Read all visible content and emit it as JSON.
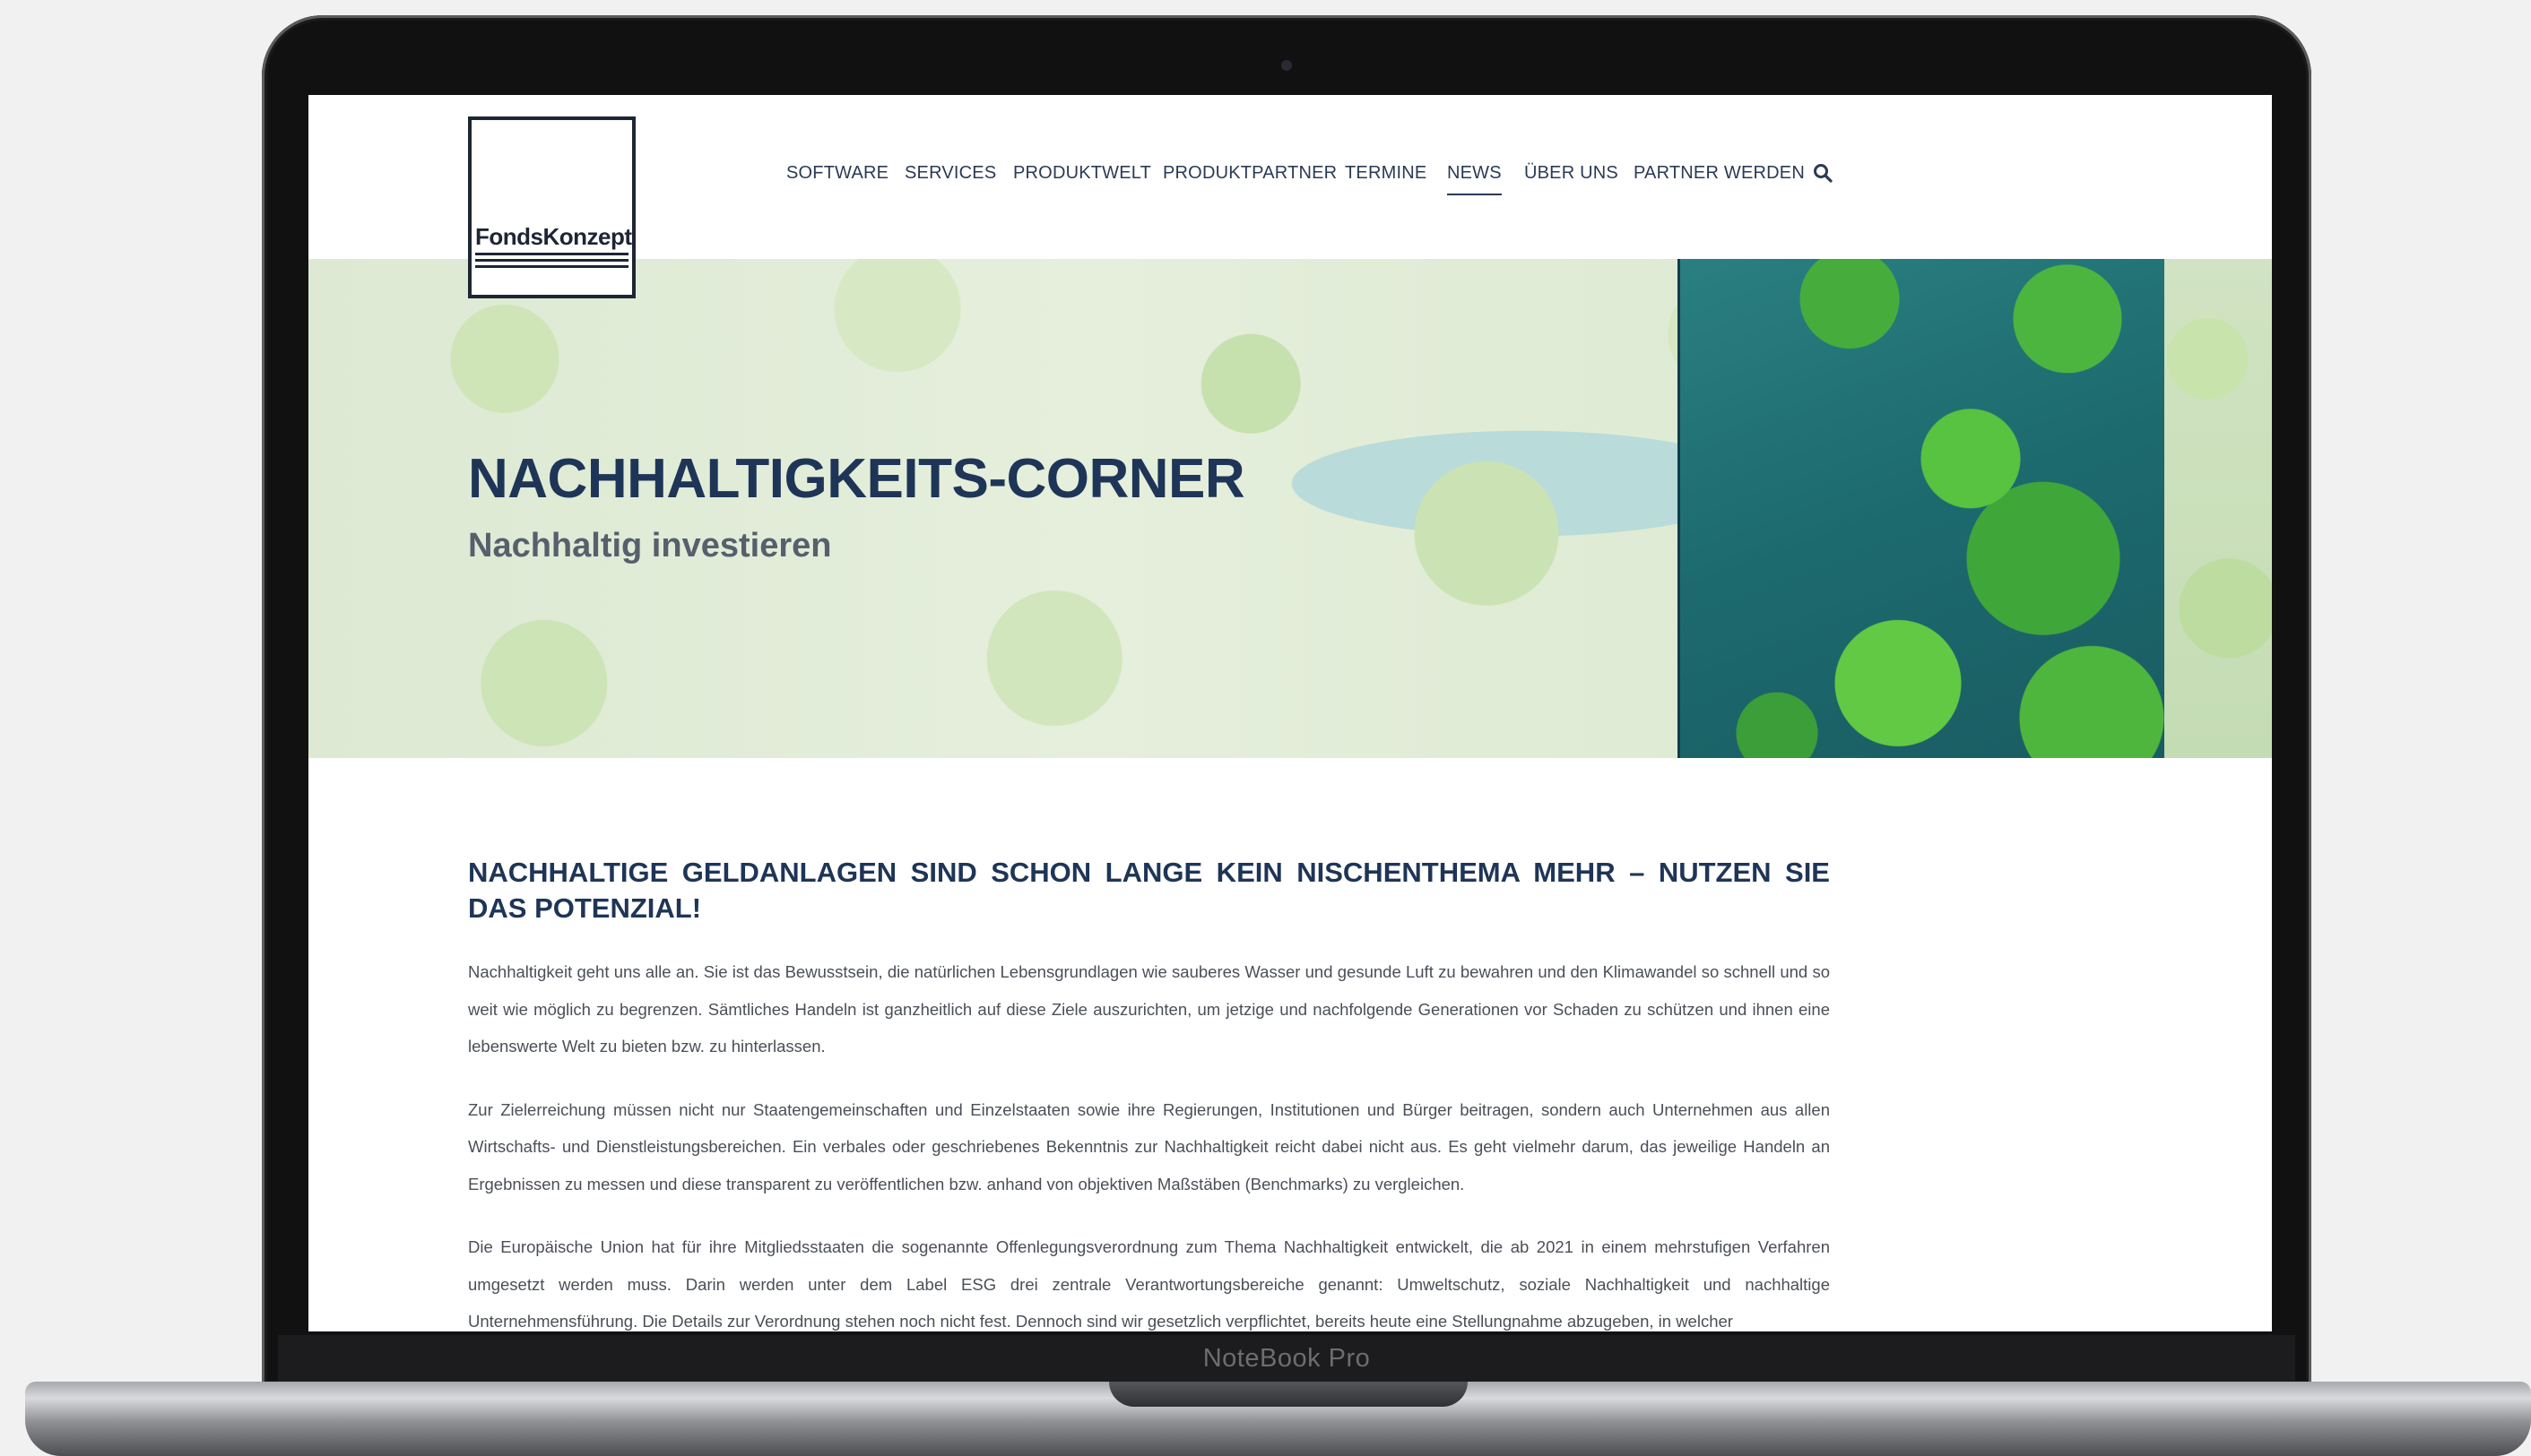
{
  "device": {
    "label": "NoteBook Pro"
  },
  "site": {
    "logo_text": "FondsKonzept",
    "nav": [
      "SOFTWARE",
      "SERVICES",
      "PRODUKTWELT",
      "PRODUKTPARTNER",
      "TERMINE",
      "NEWS",
      "ÜBER UNS",
      "PARTNER WERDEN"
    ],
    "active_nav": "NEWS",
    "search_icon": "search-icon"
  },
  "hero": {
    "title": "NACHHALTIGKEITS-CORNER",
    "subtitle": "Nachhaltig investieren"
  },
  "article": {
    "headline": "NACHHALTIGE GELDANLAGEN SIND SCHON LANGE KEIN NISCHENTHEMA MEHR – NUTZEN SIE DAS POTENZIAL!",
    "paragraphs": [
      "Nachhaltigkeit geht uns alle an. Sie ist das Bewusstsein, die natürlichen Lebensgrundlagen wie sauberes Wasser und gesunde Luft zu bewahren und den Klimawandel so schnell und so weit wie möglich zu begrenzen. Sämtliches Handeln ist ganzheitlich auf diese Ziele auszurichten, um jetzige und nachfolgende Generationen vor Schaden zu schützen und ihnen eine lebenswerte Welt zu bieten bzw. zu hinterlassen.",
      "Zur Zielerreichung müssen nicht nur Staatengemeinschaften und Einzelstaaten sowie ihre Regierungen, Institutionen und Bürger beitragen, sondern auch Unternehmen aus allen Wirtschafts- und Dienstleistungsbereichen. Ein verbales oder geschriebenes Bekenntnis zur Nachhaltigkeit reicht dabei nicht aus. Es geht vielmehr darum, das jeweilige Handeln an Ergebnissen zu messen und diese transparent zu veröffentlichen bzw. anhand von objektiven Maßstäben (Benchmarks) zu vergleichen.",
      "Die Europäische Union hat für ihre Mitgliedsstaaten die sogenannte Offenlegungsverordnung zum Thema Nachhaltigkeit entwickelt, die ab 2021 in einem mehrstufigen Verfahren umgesetzt werden muss. Darin werden unter dem Label ESG drei zentrale Verantwortungsbereiche genannt: Umweltschutz, soziale Nachhaltigkeit und nachhaltige Unternehmensführung. Die Details zur Verordnung stehen noch nicht fest. Dennoch sind wir gesetzlich verpflichtet, bereits heute eine Stellungnahme abzugeben, in welcher"
    ]
  }
}
